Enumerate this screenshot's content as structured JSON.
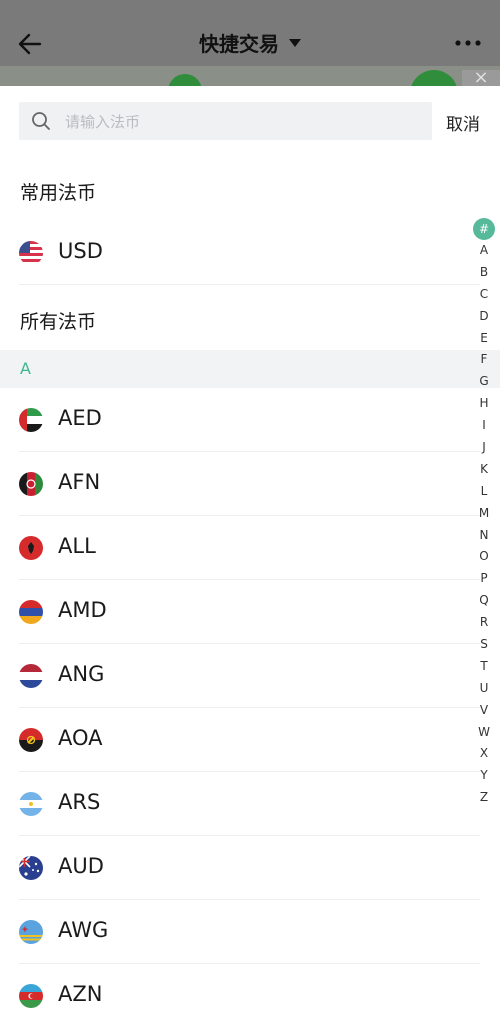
{
  "background_page": {
    "title": "快捷交易",
    "close_glyph": "×"
  },
  "search": {
    "placeholder": "请输入法币",
    "value": "",
    "cancel_label": "取消"
  },
  "common_section": {
    "label": "常用法币",
    "items": [
      {
        "code": "USD",
        "flag": "us-flag-icon"
      }
    ]
  },
  "all_section": {
    "label": "所有法币",
    "groups": [
      {
        "letter": "A",
        "items": [
          {
            "code": "AED",
            "flag": "uae-flag-icon"
          },
          {
            "code": "AFN",
            "flag": "afghanistan-flag-icon"
          },
          {
            "code": "ALL",
            "flag": "albania-flag-icon"
          },
          {
            "code": "AMD",
            "flag": "armenia-flag-icon"
          },
          {
            "code": "ANG",
            "flag": "netherlands-antilles-flag-icon"
          },
          {
            "code": "AOA",
            "flag": "angola-flag-icon"
          },
          {
            "code": "ARS",
            "flag": "argentina-flag-icon"
          },
          {
            "code": "AUD",
            "flag": "australia-flag-icon"
          },
          {
            "code": "AWG",
            "flag": "aruba-flag-icon"
          },
          {
            "code": "AZN",
            "flag": "azerbaijan-flag-icon"
          }
        ]
      }
    ]
  },
  "index_bar": {
    "active": "#",
    "letters": [
      "A",
      "B",
      "C",
      "D",
      "E",
      "F",
      "G",
      "H",
      "I",
      "J",
      "K",
      "L",
      "M",
      "N",
      "O",
      "P",
      "Q",
      "R",
      "S",
      "T",
      "U",
      "V",
      "W",
      "X",
      "Y",
      "Z"
    ]
  },
  "colors": {
    "accent": "#3db88a",
    "index_active_bg": "#55b99a",
    "overlay": "#7a7a7a"
  }
}
